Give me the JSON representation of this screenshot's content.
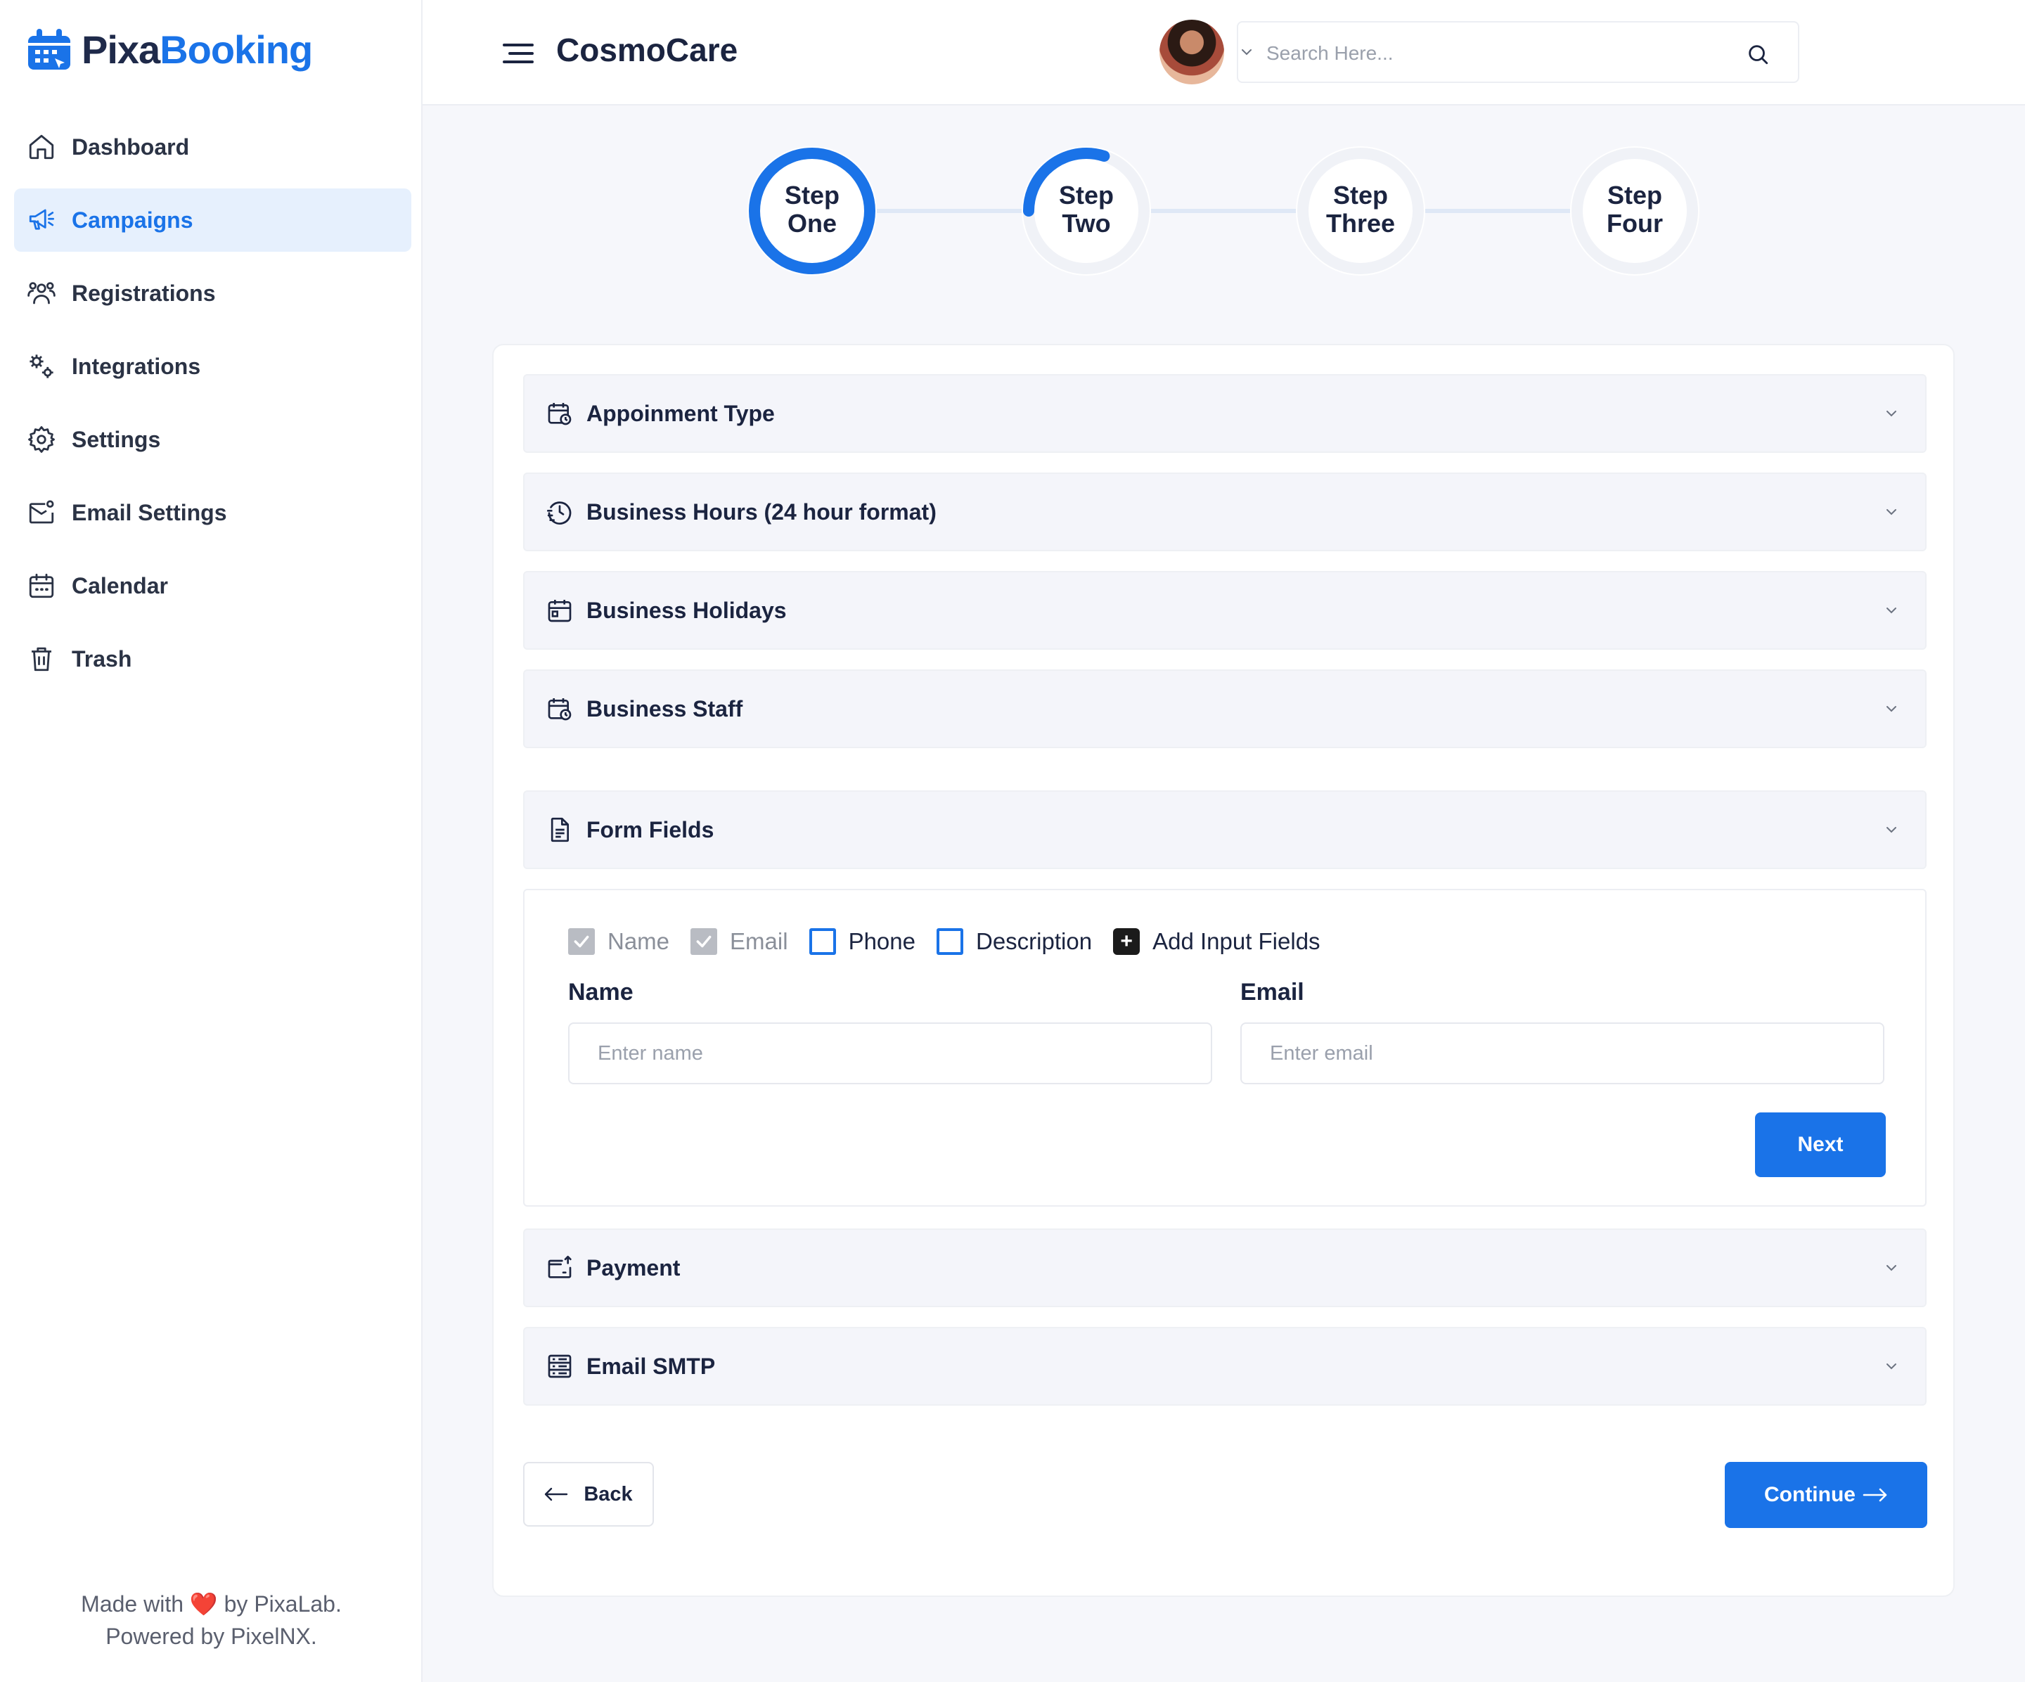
{
  "brand": {
    "part1": "Pixa",
    "part2": "Booking",
    "accent": "#1a73e8"
  },
  "sidebar": {
    "items": [
      {
        "label": "Dashboard",
        "icon": "home-icon"
      },
      {
        "label": "Campaigns",
        "icon": "megaphone-icon",
        "active": true
      },
      {
        "label": "Registrations",
        "icon": "users-icon"
      },
      {
        "label": "Integrations",
        "icon": "integrations-icon"
      },
      {
        "label": "Settings",
        "icon": "gear-icon"
      },
      {
        "label": "Email Settings",
        "icon": "email-settings-icon"
      },
      {
        "label": "Calendar",
        "icon": "calendar-icon"
      },
      {
        "label": "Trash",
        "icon": "trash-icon"
      }
    ],
    "footer": {
      "line1_pre": "Made with",
      "heart": "❤️",
      "line1_post": "by PixaLab.",
      "line2": "Powered by PixelNX."
    }
  },
  "header": {
    "title": "CosmoCare",
    "search_placeholder": "Search Here..."
  },
  "stepper": {
    "steps": [
      {
        "line1": "Step",
        "line2": "One",
        "progress": 1.0
      },
      {
        "line1": "Step",
        "line2": "Two",
        "progress": 0.3
      },
      {
        "line1": "Step",
        "line2": "Three",
        "progress": 0
      },
      {
        "line1": "Step",
        "line2": "Four",
        "progress": 0
      }
    ]
  },
  "accordion": {
    "appointment_type": "Appoinment Type",
    "business_hours": "Business Hours (24 hour format)",
    "business_holidays": "Business Holidays",
    "business_staff": "Business Staff",
    "form_fields": "Form Fields",
    "payment": "Payment",
    "email_smtp": "Email SMTP"
  },
  "form_fields": {
    "options": [
      {
        "label": "Name",
        "state": "checked-disabled"
      },
      {
        "label": "Email",
        "state": "checked-disabled"
      },
      {
        "label": "Phone",
        "state": "unchecked"
      },
      {
        "label": "Description",
        "state": "unchecked"
      },
      {
        "label": "Add Input Fields",
        "state": "add"
      }
    ],
    "name_label": "Name",
    "name_placeholder": "Enter name",
    "email_label": "Email",
    "email_placeholder": "Enter email",
    "next_label": "Next"
  },
  "actions": {
    "back_label": "Back",
    "continue_label": "Continue"
  }
}
